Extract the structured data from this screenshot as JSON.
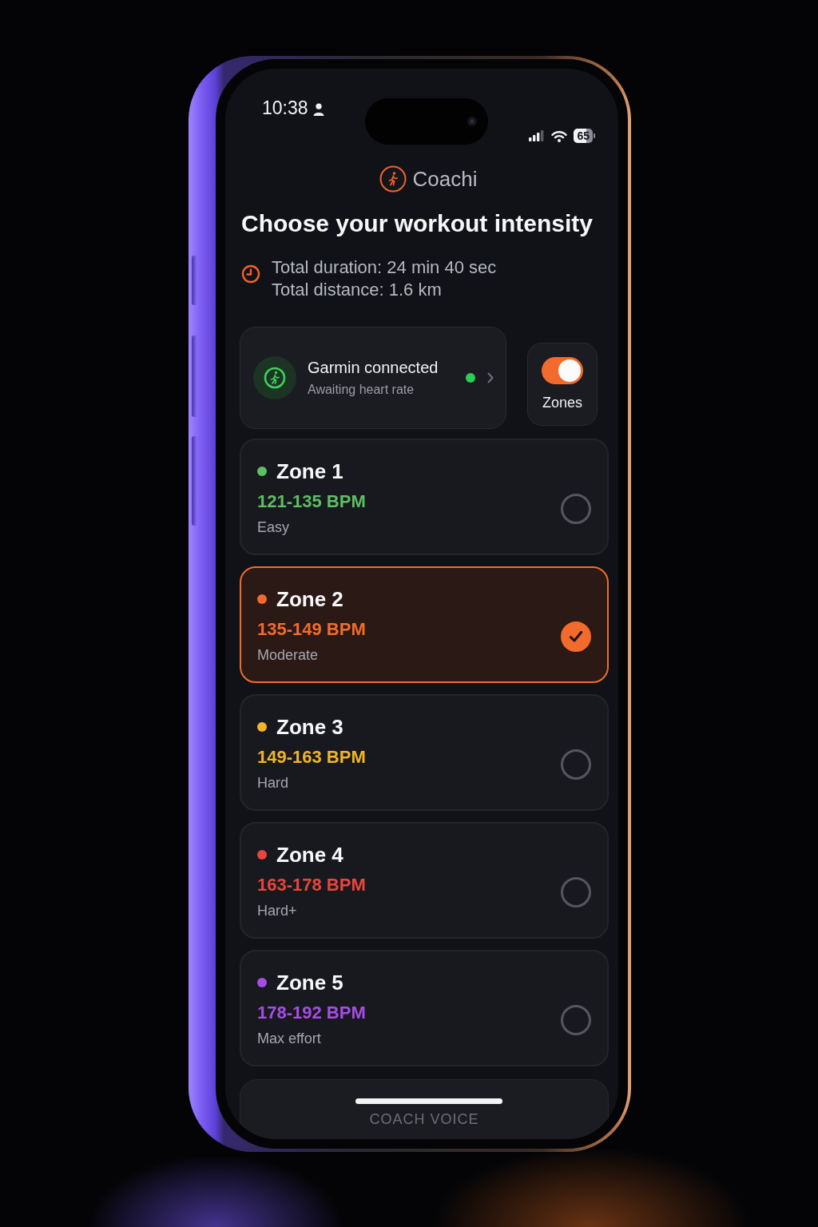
{
  "status_bar": {
    "time": "10:38",
    "battery": "65"
  },
  "app": {
    "name": "Coachi"
  },
  "header": {
    "title": "Choose your workout intensity",
    "duration": "Total duration: 24 min 40 sec",
    "distance": "Total distance: 1.6 km"
  },
  "device": {
    "title": "Garmin connected",
    "subtitle": "Awaiting heart rate",
    "connected": true
  },
  "zones_toggle": {
    "label": "Zones",
    "on": true
  },
  "zones": [
    {
      "name": "Zone 1",
      "range": "121-135 BPM",
      "effort": "Easy",
      "color": "#5cbf63",
      "selected": false
    },
    {
      "name": "Zone 2",
      "range": "135-149 BPM",
      "effort": "Moderate",
      "color": "#f26b2d",
      "selected": true
    },
    {
      "name": "Zone 3",
      "range": "149-163 BPM",
      "effort": "Hard",
      "color": "#f0b429",
      "selected": false
    },
    {
      "name": "Zone 4",
      "range": "163-178 BPM",
      "effort": "Hard+",
      "color": "#e8453c",
      "selected": false
    },
    {
      "name": "Zone 5",
      "range": "178-192 BPM",
      "effort": "Max effort",
      "color": "#a64de6",
      "selected": false
    }
  ],
  "bottom_panel": {
    "label": "COACH VOICE"
  }
}
